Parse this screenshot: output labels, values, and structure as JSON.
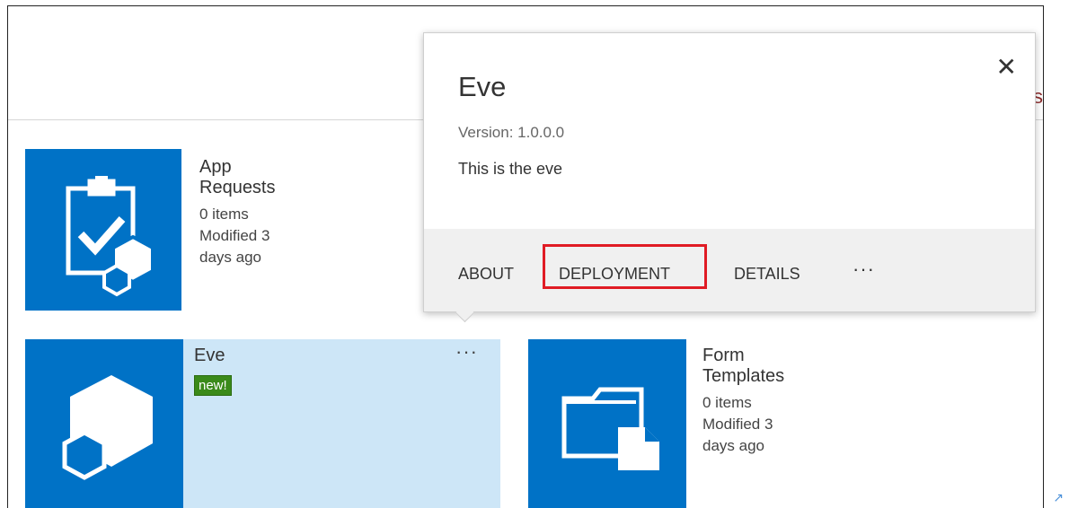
{
  "tiles": {
    "app_requests": {
      "title": "App Requests",
      "count": "0 items",
      "modified": "Modified 3 days ago"
    },
    "eve": {
      "title": "Eve",
      "badge": "new!",
      "more": "···"
    },
    "form_templates": {
      "title": "Form Templates",
      "count": "0 items",
      "modified": "Modified 3 days ago"
    }
  },
  "callout": {
    "title": "Eve",
    "version": "Version: 1.0.0.0",
    "description": "This is the eve",
    "close": "✕",
    "actions": {
      "about": "ABOUT",
      "deployment": "DEPLOYMENT",
      "details": "DETAILS",
      "more": "···"
    }
  },
  "icons": {
    "tile_icon_color": "#0072c6",
    "highlight_color": "#e01b24",
    "badge_color": "#3a8a1a"
  }
}
